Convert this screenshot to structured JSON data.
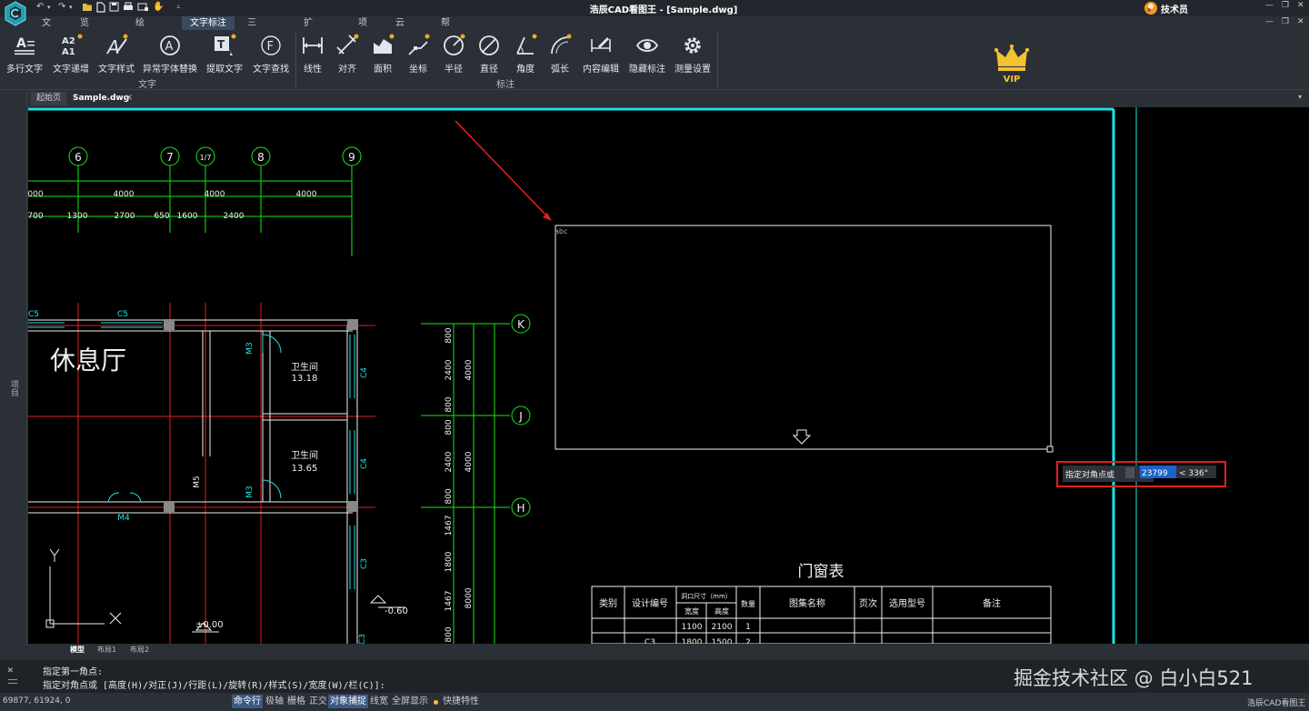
{
  "app": {
    "title": "浩辰CAD看图王 - [Sample.dwg]",
    "user_name": "技术员",
    "window_buttons": [
      "—",
      "❐",
      "✕"
    ],
    "sub_buttons": [
      "—",
      "❐",
      "✕"
    ]
  },
  "menu": [
    "文件",
    "览图测量",
    "绘图修改",
    "文字标注",
    "三维视图",
    "扩展工具",
    "项目",
    "云批注",
    "帮助"
  ],
  "menu_active_index": 3,
  "ribbon": {
    "text_group": {
      "label": "文字",
      "tools": [
        "多行文字",
        "文字递增",
        "文字样式",
        "异常字体替换",
        "提取文字",
        "文字查找"
      ]
    },
    "dim_group": {
      "label": "标注",
      "tools": [
        "线性",
        "对齐",
        "面积",
        "坐标",
        "半径",
        "直径",
        "角度",
        "弧长",
        "内容编辑",
        "隐藏标注",
        "测量设置"
      ]
    },
    "vip_label": "VIP",
    "colors": {
      "vip": "#f2c230",
      "accent_dot": "#f5a623",
      "tool_icon": "#dfe6ef"
    }
  },
  "tabs": [
    "起始页",
    "Sample.dwg"
  ],
  "tab_close": "×",
  "left_panel_label": "项目",
  "drawing": {
    "axis_top": [
      "6",
      "7",
      "1/7",
      "8",
      "9"
    ],
    "dim_row1": [
      "000",
      "4000",
      "4000",
      "4000"
    ],
    "dim_row2": [
      "700",
      "1300",
      "2700",
      "650",
      "1600",
      "2400"
    ],
    "axis_right": [
      "K",
      "J",
      "H"
    ],
    "vert_dims": [
      "800",
      "2400",
      "800",
      "800",
      "2400",
      "800",
      "1467",
      "1800",
      "1467",
      "800"
    ],
    "vert_dims_outer": [
      "4000",
      "4000",
      "8000"
    ],
    "room_big": "休息厅",
    "rooms": [
      {
        "name": "卫生间",
        "area": "13.18"
      },
      {
        "name": "卫生间",
        "area": "13.65"
      }
    ],
    "labels": {
      "c5a": "C5",
      "c5b": "C5",
      "m3a": "M3",
      "m3b": "M3",
      "c4a": "C4",
      "c4b": "C4",
      "c3a": "C3",
      "c3b": "C3",
      "m5": "M5",
      "m4": "M4",
      "elev_low": "-0.60",
      "elev_zero": "±0.00",
      "ucs_y": "Y",
      "ucs_x": "X"
    },
    "text_frame_label": "abc",
    "table_title": "门窗表",
    "table_headers": [
      "类别",
      "设计编号",
      "洞口尺寸（mm）",
      "数量",
      "图集名称",
      "页次",
      "选用型号",
      "备注"
    ],
    "table_subheaders": [
      "宽度",
      "高度"
    ],
    "table_rows": [
      [
        "",
        "",
        "1100",
        "2100",
        "1",
        "",
        "",
        "",
        ""
      ],
      [
        "",
        "C3",
        "1800",
        "1500",
        "2",
        "",
        "",
        "",
        ""
      ]
    ],
    "prompt_label": "指定对角点或",
    "prompt_value": "23799",
    "prompt_angle": "< 336°",
    "colors": {
      "green": "#19e619",
      "red": "#e02020",
      "cyan": "#19e6e6",
      "white": "#f0f0f0",
      "yellow": "#e6e619",
      "highlight": "#e02020",
      "selection": "#1c63c9"
    }
  },
  "layout_tabs": [
    "模型",
    "布局1",
    "布局2"
  ],
  "command": {
    "line1": "指定第一角点:",
    "line2": "指定对角点或 [高度(H)/对正(J)/行距(L)/旋转(R)/样式(S)/宽度(W)/栏(C)]:",
    "close": "✕"
  },
  "watermark": "掘金技术社区 @ 白小白521",
  "status": {
    "coords": "69877, 61924, 0",
    "toggles": [
      {
        "label": "命令行",
        "on": true
      },
      {
        "label": "极轴",
        "on": false
      },
      {
        "label": "栅格",
        "on": false
      },
      {
        "label": "正交",
        "on": false
      },
      {
        "label": "对象捕捉",
        "on": true
      },
      {
        "label": "线宽",
        "on": false
      },
      {
        "label": "全屏显示",
        "on": false
      },
      {
        "label": "快捷特性",
        "on": false
      }
    ],
    "product": "浩辰CAD看图王"
  }
}
